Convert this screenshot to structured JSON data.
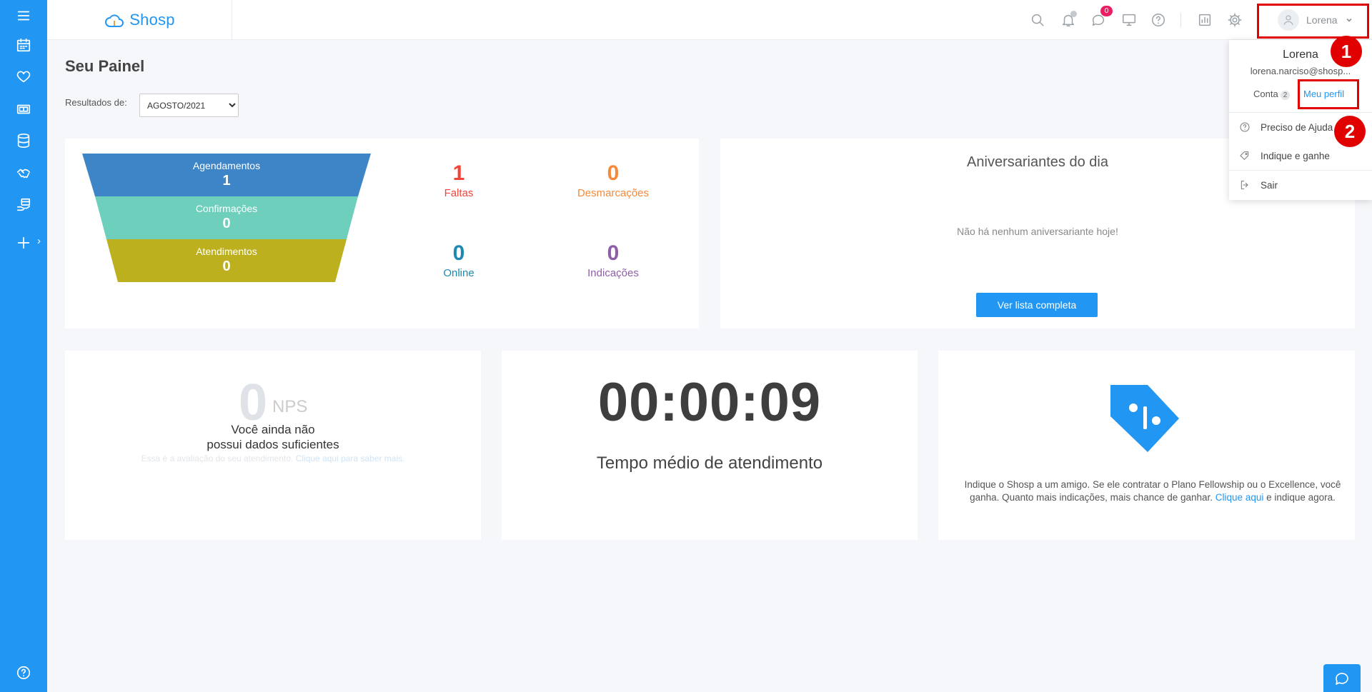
{
  "brand": {
    "name": "Shosp",
    "color": "#2196f3"
  },
  "header": {
    "icons": [
      "search-icon",
      "bell-icon",
      "chat-icon",
      "monitor-icon",
      "help-icon",
      "report-icon",
      "gear-icon"
    ],
    "messages_badge": "0",
    "user_name": "Lorena"
  },
  "sidebar": {
    "items": [
      "menu-icon",
      "calendar-icon",
      "heart-icon",
      "cash-icon",
      "database-icon",
      "handshake-icon",
      "hand-card-icon",
      "plus-icon"
    ],
    "expand_glyph": "›",
    "bottom": "help-icon"
  },
  "page": {
    "title": "Seu Painel",
    "results_label": "Resultados de:",
    "period_selected": "AGOSTO/2021"
  },
  "funnel": {
    "stages": [
      {
        "label": "Agendamentos",
        "value": "1",
        "color": "#3d85c6"
      },
      {
        "label": "Confirmações",
        "value": "0",
        "color": "#6ecfbd"
      },
      {
        "label": "Atendimentos",
        "value": "0",
        "color": "#bcb01f"
      }
    ]
  },
  "stats": [
    {
      "value": "1",
      "label": "Faltas",
      "color": "#f0453a"
    },
    {
      "value": "0",
      "label": "Desmarcações",
      "color": "#f58a3c"
    },
    {
      "value": "0",
      "label": "Online",
      "color": "#1e88b0"
    },
    {
      "value": "0",
      "label": "Indicações",
      "color": "#8e5ea8"
    }
  ],
  "birthdays": {
    "title": "Aniversariantes do dia",
    "empty_message": "Não há nenhum aniversariante hoje!",
    "button": "Ver lista completa"
  },
  "nps": {
    "value": "0",
    "label": "NPS",
    "line1": "Você ainda não",
    "line2": "possui dados suficientes",
    "sub_text": "Essa é a avaliação do seu atendimento.",
    "sub_link": "Clique aqui para saber mais."
  },
  "timer": {
    "value": "00:00:09",
    "label": "Tempo médio de atendimento"
  },
  "referral": {
    "text_before": "Indique o Shosp a um amigo. Se ele contratar o Plano Fellowship ou o Excellence, você ganha. Quanto mais indicações, mais chance de ganhar.",
    "link": "Clique aqui",
    "text_after": "e indique agora."
  },
  "user_dropdown": {
    "name": "Lorena",
    "email": "lorena.narciso@shosp...",
    "account_label": "Conta",
    "account_count": "2",
    "profile_link": "Meu perfil",
    "items": [
      {
        "label": "Preciso de Ajuda",
        "icon": "help-icon"
      },
      {
        "label": "Indique e ganhe",
        "icon": "tag-icon"
      },
      {
        "label": "Sair",
        "icon": "logout-icon"
      }
    ]
  },
  "annotations": {
    "step1": "1",
    "step2": "2",
    "color": "#e00000"
  }
}
